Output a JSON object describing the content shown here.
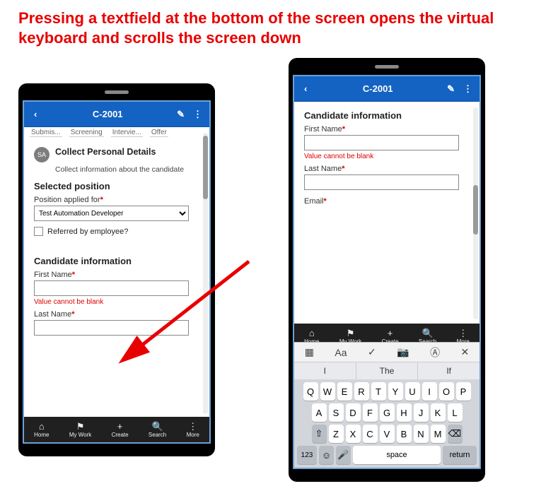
{
  "caption": "Pressing a textfield at the bottom of the  screen opens the virtual keyboard and scrolls the screen down",
  "header": {
    "title": "C-2001"
  },
  "tabs": [
    "Submis...",
    "Screening",
    "Intervie...",
    "Offer"
  ],
  "collect": {
    "avatar_initials": "SA",
    "title": "Collect Personal Details",
    "subtitle": "Collect information about the candidate"
  },
  "section_selected": "Selected position",
  "position": {
    "label": "Position applied for",
    "value": "Test Automation Developer"
  },
  "referred_label": "Referred by employee?",
  "section_candidate": "Candidate information",
  "fields": {
    "first_name": "First Name",
    "last_name": "Last Name",
    "email": "Email",
    "blank_error": "Value cannot be blank"
  },
  "nav": {
    "home": "Home",
    "mywork": "My Work",
    "create": "Create",
    "search": "Search",
    "more": "More"
  },
  "kbd": {
    "sugg": [
      "I",
      "The",
      "If"
    ],
    "row1": [
      "Q",
      "W",
      "E",
      "R",
      "T",
      "Y",
      "U",
      "I",
      "O",
      "P"
    ],
    "row2": [
      "A",
      "S",
      "D",
      "F",
      "G",
      "H",
      "J",
      "K",
      "L"
    ],
    "row3_shift": "⇧",
    "row3": [
      "Z",
      "X",
      "C",
      "V",
      "B",
      "N",
      "M"
    ],
    "row3_bksp": "⌫",
    "n123": "123",
    "emoji": "☺",
    "mic": "🎤",
    "space": "space",
    "return": "return",
    "toolbar_close": "✕"
  }
}
